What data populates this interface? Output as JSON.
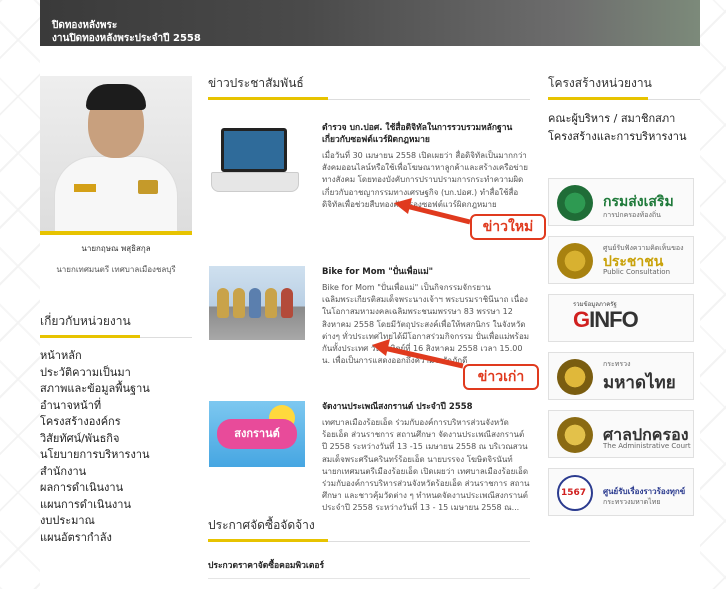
{
  "banner": {
    "line1": "ปิดทองหลังพระ",
    "line2": "งานปิดทองหลังพระประจำปี 2558"
  },
  "profile": {
    "name": "นายกฤษณ พสุธิสกุล",
    "position": "นายกเทศมนตรี เทศบาลเมืองชลบุรี"
  },
  "about": {
    "title": "เกี่ยวกับหน่วยงาน",
    "items": [
      "หน้าหลัก",
      "ประวัติความเป็นมา",
      "สภาพและข้อมูลพื้นฐาน",
      "อำนาจหน้าที่",
      "โครงสร้างองค์กร",
      "วิสัยทัศน์/พันธกิจ",
      "นโยบายการบริหารงาน",
      "สำนักงาน",
      "ผลการดำเนินงาน",
      "แผนการดำเนินงาน",
      "งบประมาณ",
      "แผนอัตรากำลัง"
    ]
  },
  "news": {
    "title": "ข่าวประชาสัมพันธ์",
    "items": [
      {
        "title": "ตำรวจ บก.ปอศ. ใช้สื่อดิจิทัลในการรวบรวมหลักฐานเกี่ยวกับซอฟต์แวร์ผิดกฎหมาย",
        "desc": "เมื่อวันที่ 30 เมษายน 2558 เปิดเผยว่า สื่อดิจิทัลเป็นมากกว่าสังคมออนไลน์หรือใช้เพื่อโฆษณาหาลูกค้าและสร้างเครือข่ายทางสังคม โดยทองบังคับการปราบปรามการกระทำความผิดเกี่ยวกับอาชญากรรมทางเศรษฐกิจ (บก.ปอศ.) ทำสื่อใช้สื่อดิจิทัลเพื่อช่วยสืบทองคัดกรองซอฟต์แวร์ผิดกฎหมาย"
      },
      {
        "title": "Bike for Mom \"ปั่นเพื่อแม่\"",
        "desc": "Bike for Mom \"ปั่นเพื่อแม่\" เป็นกิจกรรมจักรยานเฉลิมพระเกียรติสมเด็จพระนางเจ้าฯ พระบรมราชินีนาถ เนื่องในโอกาสมหามงคลเฉลิมพระชนมพรรษา 83 พรรษา 12 สิงหาคม 2558 โดยมีวัตถุประสงค์เพื่อให้พสกนิกร ในจังหวัดต่างๆ ทั่วประเทศไทยได้มีโอกาสร่วมกิจกรรม ปั่นเพื่อแม่พร้อมกันทั้งประเทศ วันอาทิตย์ที่ 16 สิงหาคม 2558 เวลา 15.00 น. เพื่อเป็นการแสดงออกถึงความจงรักภักดี"
      },
      {
        "title": "จัดงานประเพณีสงกรานต์ ประจำปี 2558",
        "desc": "เทศบาลเมืองร้อยเอ็ด ร่วมกับองค์การบริหารส่วนจังหวัดร้อยเอ็ด ส่วนราชการ สถานศึกษา จัดงานประเพณีสงกรานต์ ปี 2558 ระหว่างวันที่ 13 -15 เมษายน 2558 ณ บริเวณสวนสมเด็จพระศรีนครินทร์ร้อยเอ็ด นายบรรจง โฆษิตจิรนันท์ นายกเทศมนตรีเมืองร้อยเอ็ด เปิดเผยว่า เทศบาลเมืองร้อยเอ็ด ร่วมกับองค์การบริหารส่วนจังหวัดร้อยเอ็ด ส่วนราชการ สถานศึกษา และชาวคุ้มวัดต่าง ๆ ทำหนดจัดงานประเพณีสงกรานต์ประจำปี 2558 ระหว่างวันที่ 13 - 15 เมษายน 2558 ณ...",
        "thumb_text": "สงกรานต์"
      }
    ]
  },
  "procurement": {
    "title": "ประกาศจัดซื้อจัดจ้าง",
    "item": "ประกวดราคาจัดซื้อคอมพิวเตอร์"
  },
  "structure": {
    "title": "โครงสร้างหน่วยงาน",
    "links": [
      "คณะผู้บริหาร / สมาชิกสภา",
      "โครงสร้างและการบริหารงาน"
    ]
  },
  "logos": [
    {
      "big": "กรมส่งเสริม",
      "small": "การปกครองท้องถิ่น",
      "color": "#1f7a3a"
    },
    {
      "big": "ประชาชน",
      "small": "Public Consultation",
      "small_top": "ศูนย์รับฟังความคิดเห็นของ",
      "color": "#c9a20a"
    },
    {
      "big": "GINFO",
      "small_top": "รวมข้อมูลภาครัฐ",
      "color": "#d0201f"
    },
    {
      "big": "มหาดไทย",
      "small_top": "กระทรวง",
      "color": "#333333"
    },
    {
      "big": "ศาลปกครอง",
      "small": "The Administrative Court",
      "color": "#333333"
    },
    {
      "big": "ศูนย์รับเรื่องราวร้องทุกข์",
      "small": "กระทรวงมหาดไทย",
      "badge": "1567",
      "color": "#2b3b8f"
    }
  ],
  "annotations": {
    "new_news": "ข่าวใหม่",
    "old_news": "ข่าวเก่า",
    "color": "#e03a1e"
  }
}
